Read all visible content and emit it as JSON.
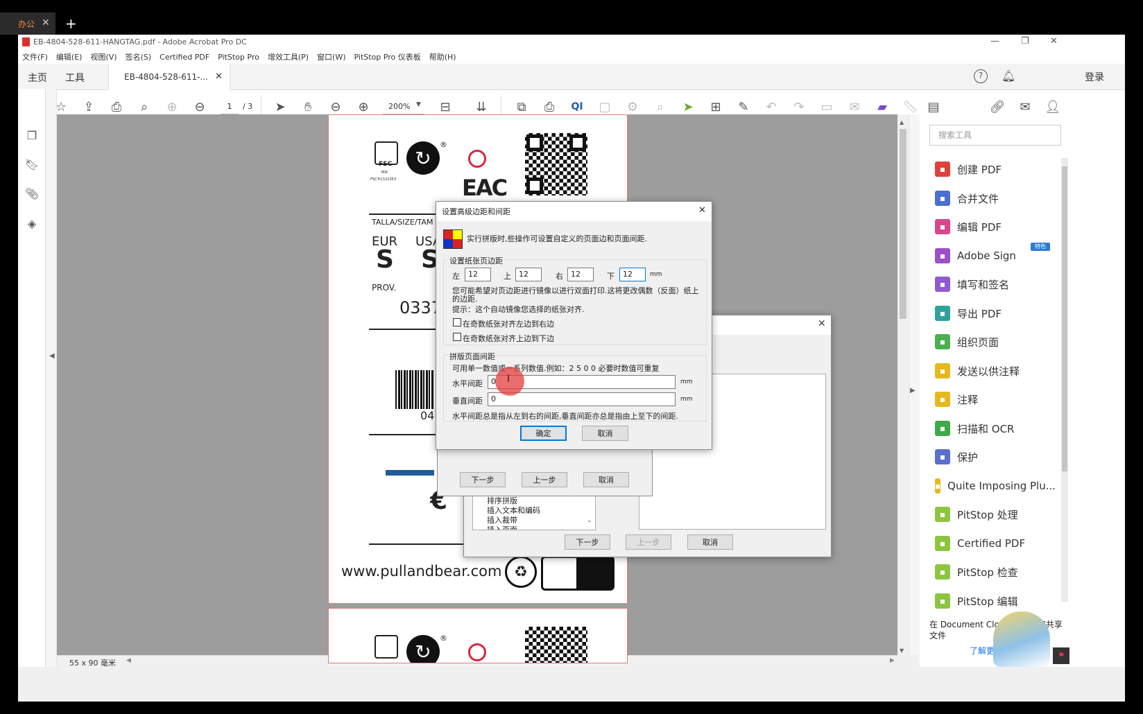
{
  "outer_tabs": {
    "active_label": "办公",
    "close": "✕",
    "new_tab": "+"
  },
  "window": {
    "title": "EB-4804-528-611-HANGTAG.pdf - Adobe Acrobat Pro DC",
    "collapse_glyph": "⌄",
    "min": "—",
    "restore": "❐",
    "close": "✕"
  },
  "menu": [
    "文件(F)",
    "编辑(E)",
    "视图(V)",
    "签名(S)",
    "Certified PDF",
    "PitStop Pro",
    "增效工具(P)",
    "窗口(W)",
    "PitStop Pro 仪表板",
    "帮助(H)"
  ],
  "tabs": {
    "home": "主页",
    "tools": "工具",
    "doc": "EB-4804-528-611-...",
    "doc_close": "✕",
    "login": "登录"
  },
  "toolbar": {
    "page_current": "1",
    "page_total": "/ 3",
    "zoom": "200%"
  },
  "status": {
    "page_size": "55 x 90 毫米"
  },
  "pdf": {
    "fsc_text": "FSC",
    "fsc_mix": "MIX",
    "fsc_code": "FSC®C121353",
    "registered": "®",
    "eac": "EAC",
    "size_header": "TALLA/SIZE/TAM",
    "eur": "EUR",
    "usa": "USA",
    "size_s1": "S",
    "size_s2": "S",
    "prov": "PROV.",
    "prov_code": "0337",
    "barcode_num": "04",
    "euro": "€",
    "website": "www.pullandbear.com"
  },
  "right_panel": {
    "search_placeholder": "搜索工具",
    "featured": "特色",
    "tools": [
      {
        "label": "创建 PDF",
        "color": "#e0423a",
        "icon": "create-pdf-icon"
      },
      {
        "label": "合并文件",
        "color": "#4a6fd0",
        "icon": "combine-files-icon"
      },
      {
        "label": "编辑 PDF",
        "color": "#d8478a",
        "icon": "edit-pdf-icon"
      },
      {
        "label": "Adobe Sign",
        "color": "#9b4fc8",
        "icon": "adobe-sign-icon"
      },
      {
        "label": "填写和签名",
        "color": "#8e5bd0",
        "icon": "fill-sign-icon"
      },
      {
        "label": "导出 PDF",
        "color": "#2fa39a",
        "icon": "export-pdf-icon"
      },
      {
        "label": "组织页面",
        "color": "#4caf50",
        "icon": "organize-pages-icon"
      },
      {
        "label": "发送以供注释",
        "color": "#e5b81e",
        "icon": "send-comment-icon"
      },
      {
        "label": "注释",
        "color": "#e5b81e",
        "icon": "comment-icon"
      },
      {
        "label": "扫描和 OCR",
        "color": "#3eaa48",
        "icon": "scan-ocr-icon"
      },
      {
        "label": "保护",
        "color": "#5b6fd0",
        "icon": "protect-icon"
      },
      {
        "label": "Quite Imposing Plu...",
        "color": "#e5b81e",
        "icon": "quite-imposing-icon"
      },
      {
        "label": "PitStop 处理",
        "color": "#8cc63f",
        "icon": "pitstop-process-icon"
      },
      {
        "label": "Certified PDF",
        "color": "#8cc63f",
        "icon": "certified-pdf-icon"
      },
      {
        "label": "PitStop 检查",
        "color": "#8cc63f",
        "icon": "pitstop-inspect-icon"
      },
      {
        "label": "PitStop 编辑",
        "color": "#8cc63f",
        "icon": "pitstop-edit-icon"
      }
    ],
    "promo": "在 Document Cloud 中存储和共享文件",
    "promo_link": "了解更多"
  },
  "wizard_back": {
    "list_items": [
      "排序拼版",
      "插入文本和编码",
      "插入裁带",
      "插入页面"
    ],
    "next": "下一步",
    "prev": "上一步",
    "cancel": "取消",
    "close": "✕"
  },
  "wizard_mid": {
    "next": "下一步",
    "prev": "上一步",
    "cancel": "取消"
  },
  "dialog": {
    "title": "设置高级边距和间距",
    "close": "✕",
    "intro": "实行拼版时,些操作可设置自定义的页面边和页面间距.",
    "margins_group": "设置纸张页边距",
    "left_label": "左",
    "left_value": "12",
    "top_label": "上",
    "top_value": "12",
    "right_label": "右",
    "right_value": "12",
    "bottom_label": "下",
    "bottom_value": "12",
    "unit": "mm",
    "mirror_note": "您可能希望对页边距进行镜像以进行双面打印.这将更改偶数（反面）纸上的边距.",
    "hint": "提示：这个自动镜像您选择的纸张对齐.",
    "check1": "在奇数纸张对齐左边到右边",
    "check2": "在奇数纸张对齐上边到下边",
    "spacing_group": "拼版页面间距",
    "spacing_note": "可用单一数值或一系列数值.例如：2 5 0 0    必要时数值可重复",
    "horiz_label": "水平间距",
    "horiz_value": "0",
    "vert_label": "垂直间距",
    "vert_value": "0",
    "spacing_unit": "mm",
    "spacing_footer": "水平间距总是指从左到右的间距,垂直间距亦总是指由上至下的间距.",
    "ok": "确定",
    "cancel": "取消"
  }
}
